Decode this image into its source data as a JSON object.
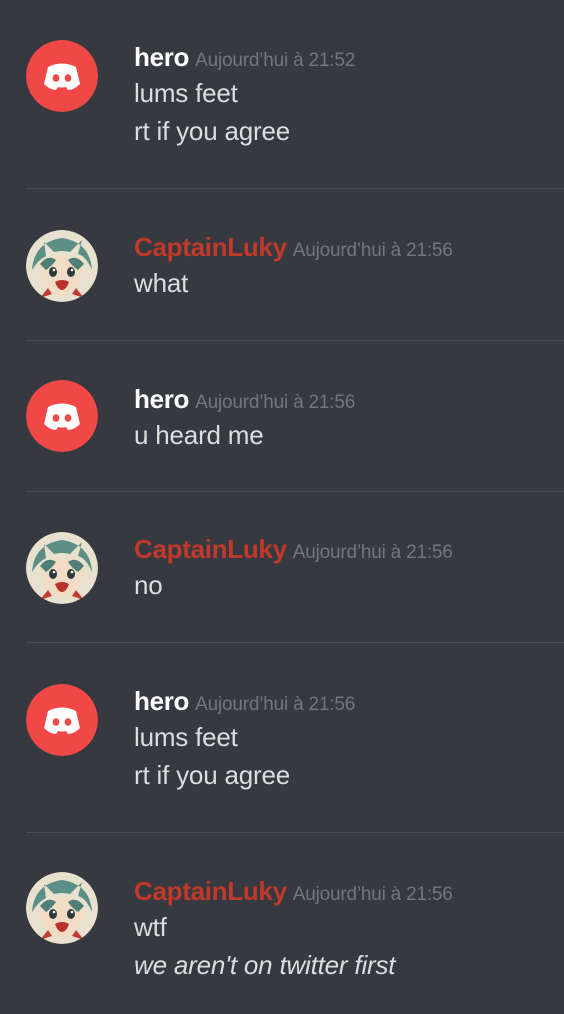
{
  "colors": {
    "background": "#36393f",
    "divider": "#4a4d54",
    "hero_name": "#ffffff",
    "luky_name": "#c0392b",
    "timestamp": "#72767d",
    "message_text": "#dcddde",
    "discord_avatar_bg": "#f04747"
  },
  "messages": [
    {
      "author": "hero",
      "avatar": "discord-logo-icon",
      "timestamp": "Aujourd’hui à 21:52",
      "lines": [
        "lums feet",
        "rt if you agree"
      ]
    },
    {
      "author": "CaptainLuky",
      "avatar": "anime-girl-avatar",
      "timestamp": "Aujourd’hui à 21:56",
      "lines": [
        "what"
      ]
    },
    {
      "author": "hero",
      "avatar": "discord-logo-icon",
      "timestamp": "Aujourd’hui à 21:56",
      "lines": [
        "u heard me"
      ]
    },
    {
      "author": "CaptainLuky",
      "avatar": "anime-girl-avatar",
      "timestamp": "Aujourd’hui à 21:56",
      "lines": [
        "no"
      ]
    },
    {
      "author": "hero",
      "avatar": "discord-logo-icon",
      "timestamp": "Aujourd’hui à 21:56",
      "lines": [
        "lums feet",
        "rt if you agree"
      ]
    },
    {
      "author": "CaptainLuky",
      "avatar": "anime-girl-avatar",
      "timestamp": "Aujourd’hui à 21:56",
      "lines": [
        "wtf",
        "we aren't on twitter first"
      ]
    }
  ]
}
